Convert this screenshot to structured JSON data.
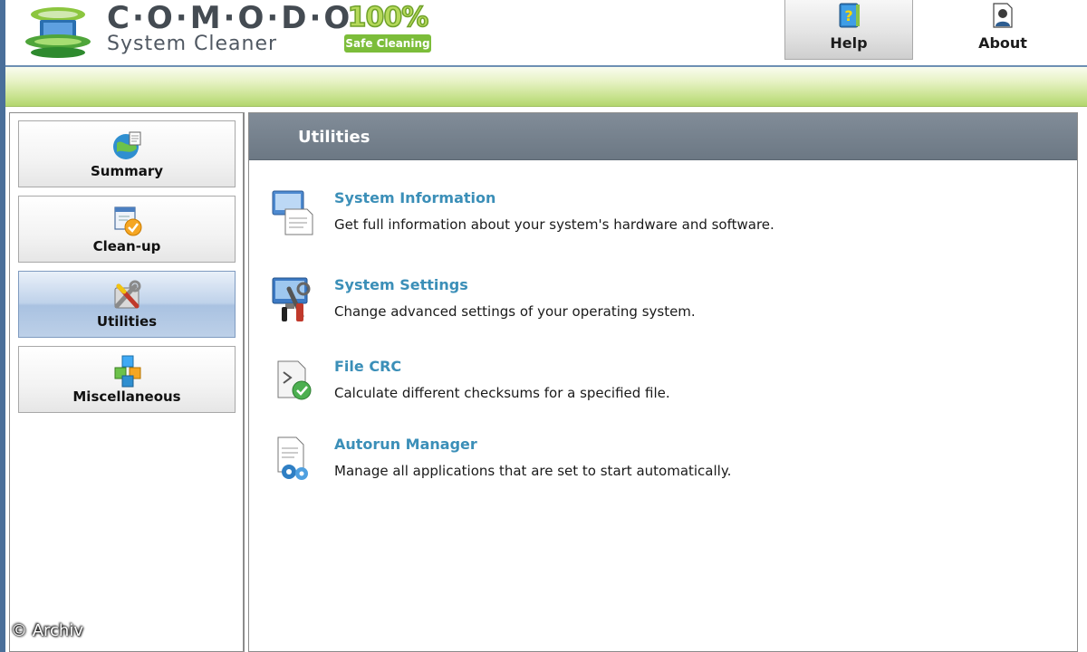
{
  "header": {
    "brand": "C·O·M·O·D·O",
    "product": "System Cleaner",
    "badge_percent": "100%",
    "badge_label": "Safe Cleaning",
    "buttons": [
      {
        "label": "Help",
        "icon": "help-book-icon"
      },
      {
        "label": "About",
        "icon": "about-person-icon"
      }
    ]
  },
  "sidebar": {
    "items": [
      {
        "label": "Summary",
        "icon": "summary-globe-icon",
        "active": false
      },
      {
        "label": "Clean-up",
        "icon": "cleanup-check-icon",
        "active": false
      },
      {
        "label": "Utilities",
        "icon": "utilities-tools-icon",
        "active": true
      },
      {
        "label": "Miscellaneous",
        "icon": "miscellaneous-cubes-icon",
        "active": false
      }
    ]
  },
  "main": {
    "title": "Utilities",
    "utilities": [
      {
        "title": "System Information",
        "description": "Get full information about your system's hardware and software.",
        "icon": "system-information-icon"
      },
      {
        "title": "System Settings",
        "description": "Change advanced settings of your operating system.",
        "icon": "system-settings-icon"
      },
      {
        "title": "File CRC",
        "description": "Calculate different checksums for a specified file.",
        "icon": "file-crc-icon"
      },
      {
        "title": "Autorun Manager",
        "description": "Manage all applications that are set to start automatically.",
        "icon": "autorun-manager-icon"
      }
    ]
  },
  "watermark": "© Archiv",
  "colors": {
    "frame_blue": "#4a6f9a",
    "green_bar": "#c9e390",
    "panel_header": "#747f8b",
    "link": "#3b8fb8",
    "badge_green": "#7cbd3a"
  }
}
